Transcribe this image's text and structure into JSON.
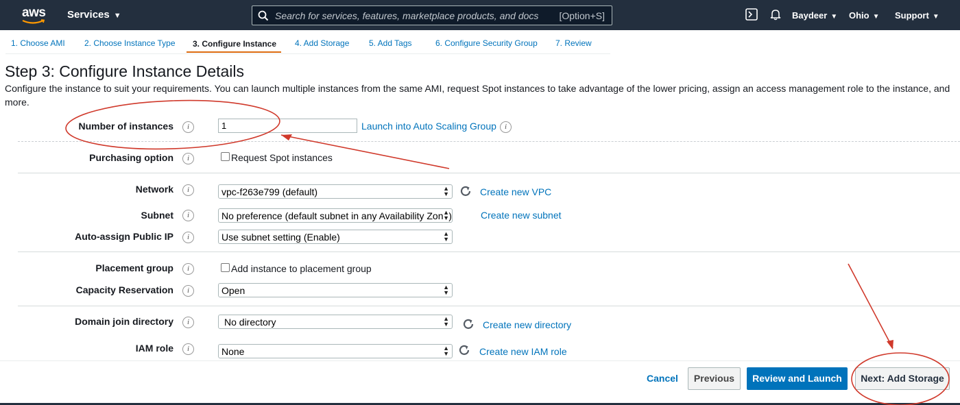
{
  "header": {
    "logo_text": "aws",
    "services_label": "Services",
    "search_placeholder": "Search for services, features, marketplace products, and docs",
    "search_shortcut": "[Option+S]",
    "user": "Baydeer",
    "region": "Ohio",
    "support": "Support"
  },
  "steps": [
    {
      "label": "1. Choose AMI"
    },
    {
      "label": "2. Choose Instance Type"
    },
    {
      "label": "3. Configure Instance",
      "active": true
    },
    {
      "label": "4. Add Storage"
    },
    {
      "label": "5. Add Tags"
    },
    {
      "label": "6. Configure Security Group"
    },
    {
      "label": "7. Review"
    }
  ],
  "page": {
    "title": "Step 3: Configure Instance Details",
    "description": "Configure the instance to suit your requirements. You can launch multiple instances from the same AMI, request Spot instances to take advantage of the lower pricing, assign an access management role to the instance, and more."
  },
  "form": {
    "instances": {
      "label": "Number of instances",
      "value": "1",
      "link": "Launch into Auto Scaling Group"
    },
    "purchasing": {
      "label": "Purchasing option",
      "checkbox": "Request Spot instances"
    },
    "network": {
      "label": "Network",
      "value": "vpc-f263e799 (default)",
      "link": "Create new VPC"
    },
    "subnet": {
      "label": "Subnet",
      "value": "No preference (default subnet in any Availability Zone)",
      "link": "Create new subnet"
    },
    "public_ip": {
      "label": "Auto-assign Public IP",
      "value": "Use subnet setting (Enable)"
    },
    "placement": {
      "label": "Placement group",
      "checkbox": "Add instance to placement group"
    },
    "capacity": {
      "label": "Capacity Reservation",
      "value": "Open"
    },
    "domain": {
      "label": "Domain join directory",
      "value": "No directory",
      "link": "Create new directory"
    },
    "iam": {
      "label": "IAM role",
      "value": "None",
      "link": "Create new IAM role"
    }
  },
  "footer": {
    "cancel": "Cancel",
    "previous": "Previous",
    "review": "Review and Launch",
    "next": "Next: Add Storage"
  },
  "info_glyph": "i",
  "colors": {
    "nav_bg": "#232f3e",
    "link": "#0073bb",
    "accent": "#dd6b10",
    "annotation": "#d0392b"
  }
}
